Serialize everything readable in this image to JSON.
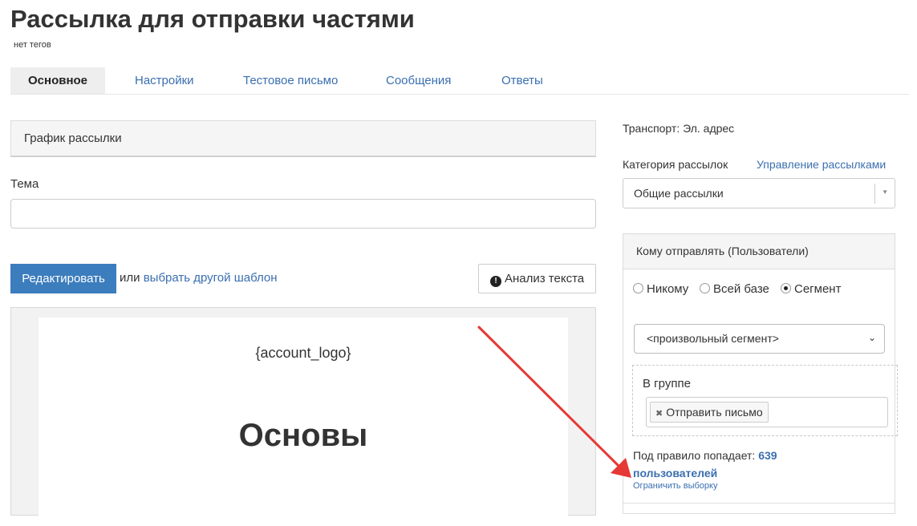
{
  "header": {
    "title": "Рассылка для отправки частями",
    "tags": "нет тегов"
  },
  "tabs": [
    {
      "label": "Основное",
      "active": true
    },
    {
      "label": "Настройки"
    },
    {
      "label": "Тестовое письмо"
    },
    {
      "label": "Сообщения"
    },
    {
      "label": "Ответы"
    }
  ],
  "main": {
    "schedule_title": "График рассылки",
    "subject_label": "Тема",
    "subject_value": "",
    "edit_button": "Редактировать",
    "or_text": "или",
    "choose_template_link": "выбрать другой шаблон",
    "analyze_button": "Анализ текста",
    "analyze_icon": "exclamation-circle-icon",
    "editor": {
      "logo_placeholder": "{account_logo}",
      "heading": "Основы"
    }
  },
  "sidebar": {
    "transport": "Транспорт: Эл. адрес",
    "category_label": "Категория рассылок",
    "manage_link": "Управление рассылками",
    "category_value": "Общие рассылки",
    "recipients": {
      "title": "Кому отправлять (Пользователи)",
      "options": [
        "Никому",
        "Всей базе",
        "Сегмент"
      ],
      "selected": "Сегмент",
      "segment_value": "<произвольный сегмент>",
      "group_label": "В группе",
      "group_chip": "Отправить письмо",
      "rule_prefix": "Под правило попадает:",
      "rule_count": "639",
      "rule_suffix": "пользователей",
      "limit_link": "Ограничить выборку"
    }
  },
  "colors": {
    "accent": "#3c7dbd",
    "link": "#3a6fb0",
    "annotation_arrow": "#e53935"
  }
}
